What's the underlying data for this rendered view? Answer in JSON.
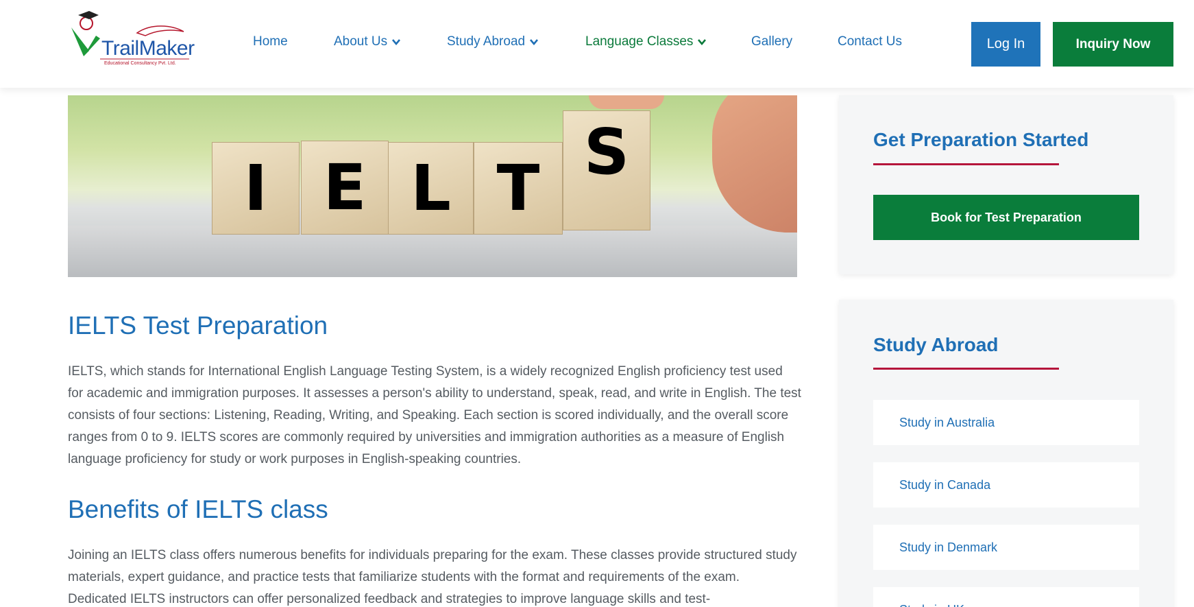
{
  "header": {
    "logo_text": "TrailMaker",
    "logo_subtext": "Educational Consultancy Pvt. Ltd.",
    "nav": [
      {
        "label": "Home"
      },
      {
        "label": "About Us"
      },
      {
        "label": "Study Abroad"
      },
      {
        "label": "Language Classes"
      },
      {
        "label": "Gallery"
      },
      {
        "label": "Contact Us"
      }
    ],
    "login_label": "Log In",
    "inquiry_label": "Inquiry Now"
  },
  "hero": {
    "letters": [
      "I",
      "E",
      "L",
      "T",
      "S"
    ]
  },
  "main": {
    "heading1": "IELTS Test Preparation",
    "para1": "IELTS, which stands for International English Language Testing System, is a widely recognized English proficiency test used for academic and immigration purposes. It assesses a person's ability to understand, speak, read, and write in English. The test consists of four sections: Listening, Reading, Writing, and Speaking. Each section is scored individually, and the overall score ranges from 0 to 9. IELTS scores are commonly required by universities and immigration authorities as a measure of English language proficiency for study or work purposes in English-speaking countries.",
    "heading2": "Benefits of IELTS class",
    "para2": "Joining an IELTS class offers numerous benefits for individuals preparing for the exam. These classes provide structured study materials, expert guidance, and practice tests that familiarize students with the format and requirements of the exam. Dedicated IELTS instructors can offer personalized feedback and strategies to improve language skills and test-"
  },
  "sidebar": {
    "prep_title": "Get Preparation Started",
    "prep_button": "Book for Test Preparation",
    "study_title": "Study Abroad",
    "study_links": [
      {
        "label": "Study in Australia"
      },
      {
        "label": "Study in Canada"
      },
      {
        "label": "Study in Denmark"
      },
      {
        "label": "Study in UK"
      }
    ]
  },
  "colors": {
    "primary_blue": "#1f6fb5",
    "brand_green": "#0a7d3b",
    "accent_red": "#b5153b"
  }
}
